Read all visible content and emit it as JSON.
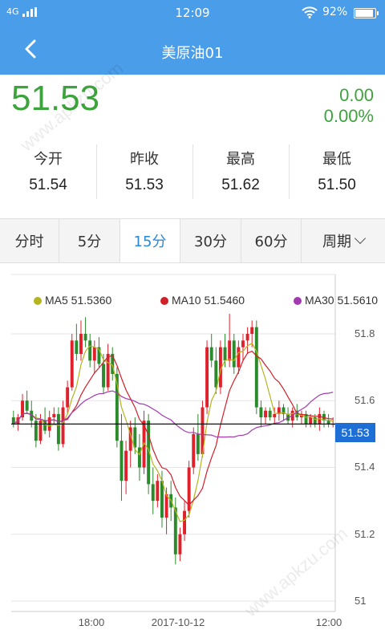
{
  "status": {
    "network": "4G",
    "time": "12:09",
    "battery": "92%"
  },
  "header": {
    "title": "美原油01"
  },
  "quote": {
    "price": "51.53",
    "change": "0.00",
    "change_pct": "0.00%",
    "color": "#3da43d"
  },
  "stats": [
    {
      "label": "今开",
      "value": "51.54"
    },
    {
      "label": "昨收",
      "value": "51.53"
    },
    {
      "label": "最高",
      "value": "51.62"
    },
    {
      "label": "最低",
      "value": "51.50"
    }
  ],
  "tabs": [
    {
      "label": "分时"
    },
    {
      "label": "5分"
    },
    {
      "label": "15分",
      "active": true
    },
    {
      "label": "30分"
    },
    {
      "label": "60分"
    },
    {
      "label": "周期"
    }
  ],
  "chart_data": {
    "type": "candlestick",
    "legend": [
      {
        "label": "MA5 51.5360",
        "color": "#b5b51f"
      },
      {
        "label": "MA10 51.5460",
        "color": "#d0202a"
      },
      {
        "label": "MA30 51.5610",
        "color": "#a33ab0"
      }
    ],
    "y_ticks": [
      "51.8",
      "51.6",
      "51.4",
      "51.2",
      "51"
    ],
    "y_values": [
      51.8,
      51.6,
      51.4,
      51.2,
      51.0
    ],
    "ylim": [
      51.0,
      51.85
    ],
    "x_ticks": [
      "18:00",
      "2017-10-12",
      "12:00"
    ],
    "current_price": "51.53",
    "current_value": 51.53,
    "up_color": "#e0202a",
    "down_color": "#2b8a2b",
    "ohlc": [
      [
        51.55,
        51.57,
        51.52,
        51.53
      ],
      [
        51.53,
        51.56,
        51.51,
        51.55
      ],
      [
        51.55,
        51.62,
        51.54,
        51.6
      ],
      [
        51.6,
        51.63,
        51.56,
        51.57
      ],
      [
        51.57,
        51.6,
        51.52,
        51.54
      ],
      [
        51.54,
        51.56,
        51.46,
        51.48
      ],
      [
        51.48,
        51.56,
        51.47,
        51.54
      ],
      [
        51.54,
        51.58,
        51.5,
        51.51
      ],
      [
        51.51,
        51.57,
        51.49,
        51.55
      ],
      [
        51.55,
        51.58,
        51.53,
        51.56
      ],
      [
        51.56,
        51.58,
        51.45,
        51.47
      ],
      [
        51.47,
        51.6,
        51.46,
        51.58
      ],
      [
        51.58,
        51.66,
        51.56,
        51.64
      ],
      [
        51.64,
        51.8,
        51.63,
        51.78
      ],
      [
        51.78,
        51.83,
        51.72,
        51.74
      ],
      [
        51.74,
        51.84,
        51.72,
        51.8
      ],
      [
        51.8,
        51.85,
        51.76,
        51.78
      ],
      [
        51.78,
        51.8,
        51.7,
        51.72
      ],
      [
        51.72,
        51.78,
        51.68,
        51.76
      ],
      [
        51.76,
        51.79,
        51.7,
        51.71
      ],
      [
        51.71,
        51.74,
        51.62,
        51.64
      ],
      [
        51.64,
        51.77,
        51.63,
        51.74
      ],
      [
        51.74,
        51.76,
        51.66,
        51.68
      ],
      [
        51.68,
        51.7,
        51.46,
        51.48
      ],
      [
        51.48,
        51.56,
        51.3,
        51.36
      ],
      [
        51.36,
        51.48,
        51.32,
        51.45
      ],
      [
        51.45,
        51.54,
        51.4,
        51.52
      ],
      [
        51.52,
        51.55,
        51.44,
        51.46
      ],
      [
        51.46,
        51.5,
        51.36,
        51.4
      ],
      [
        51.4,
        51.57,
        51.38,
        51.54
      ],
      [
        51.54,
        51.56,
        51.32,
        51.35
      ],
      [
        51.35,
        51.4,
        51.26,
        51.3
      ],
      [
        51.3,
        51.38,
        51.28,
        51.36
      ],
      [
        51.36,
        51.39,
        51.22,
        51.25
      ],
      [
        51.25,
        51.34,
        51.2,
        51.32
      ],
      [
        51.32,
        51.36,
        51.24,
        51.28
      ],
      [
        51.28,
        51.31,
        51.11,
        51.14
      ],
      [
        51.14,
        51.22,
        51.12,
        51.2
      ],
      [
        51.2,
        51.3,
        51.18,
        51.27
      ],
      [
        51.27,
        51.42,
        51.25,
        51.4
      ],
      [
        51.4,
        51.52,
        51.38,
        51.5
      ],
      [
        51.5,
        51.56,
        51.42,
        51.44
      ],
      [
        51.44,
        51.6,
        51.43,
        51.58
      ],
      [
        51.58,
        51.78,
        51.56,
        51.76
      ],
      [
        51.76,
        51.8,
        51.7,
        51.72
      ],
      [
        51.72,
        51.76,
        51.62,
        51.64
      ],
      [
        51.64,
        51.78,
        51.62,
        51.76
      ],
      [
        51.76,
        51.8,
        51.7,
        51.72
      ],
      [
        51.72,
        51.86,
        51.7,
        51.78
      ],
      [
        51.78,
        51.8,
        51.68,
        51.7
      ],
      [
        51.7,
        51.78,
        51.68,
        51.76
      ],
      [
        51.76,
        51.8,
        51.72,
        51.78
      ],
      [
        51.78,
        51.82,
        51.74,
        51.8
      ],
      [
        51.8,
        51.84,
        51.76,
        51.82
      ],
      [
        51.82,
        51.84,
        51.56,
        51.58
      ],
      [
        51.58,
        51.6,
        51.52,
        51.55
      ],
      [
        51.55,
        51.58,
        51.53,
        51.57
      ],
      [
        51.57,
        51.58,
        51.54,
        51.55
      ],
      [
        51.55,
        51.58,
        51.53,
        51.56
      ],
      [
        51.56,
        51.6,
        51.54,
        51.58
      ],
      [
        51.58,
        51.59,
        51.54,
        51.56
      ],
      [
        51.56,
        51.58,
        51.53,
        51.54
      ],
      [
        51.54,
        51.58,
        51.52,
        51.57
      ],
      [
        51.57,
        51.59,
        51.54,
        51.55
      ],
      [
        51.55,
        51.57,
        51.53,
        51.56
      ],
      [
        51.56,
        51.57,
        51.52,
        51.53
      ],
      [
        51.53,
        51.56,
        51.52,
        51.55
      ],
      [
        51.55,
        51.56,
        51.52,
        51.53
      ],
      [
        51.53,
        51.58,
        51.51,
        51.56
      ],
      [
        51.56,
        51.57,
        51.52,
        51.54
      ],
      [
        51.54,
        51.56,
        51.52,
        51.53
      ],
      [
        51.53,
        51.55,
        51.52,
        51.53
      ]
    ]
  },
  "watermark": "www.apkzu.com"
}
